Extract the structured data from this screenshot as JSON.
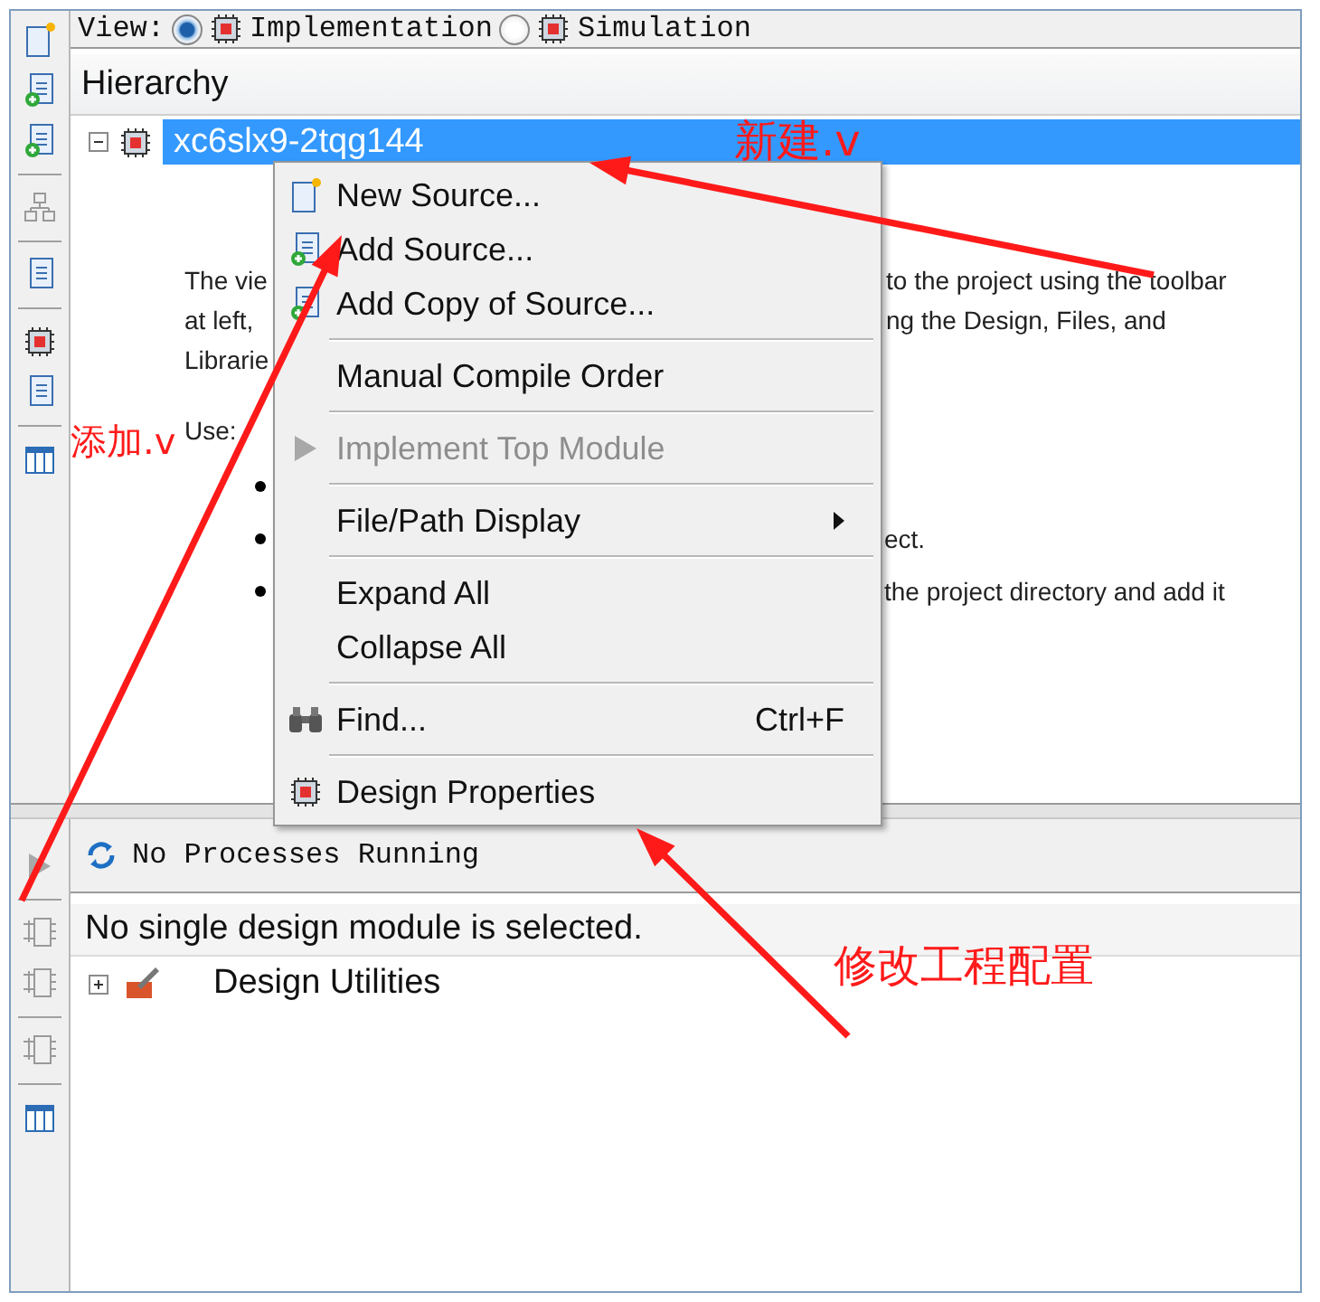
{
  "view_bar": {
    "label": "View:",
    "options": [
      {
        "label": "Implementation",
        "selected": true
      },
      {
        "label": "Simulation",
        "selected": false
      }
    ]
  },
  "hierarchy": {
    "title": "Hierarchy",
    "root": {
      "label": "xc6slx9-2tqg144",
      "selected": true,
      "expanded": true
    },
    "description": [
      {
        "left": "The vie",
        "right": "to the project using the toolbar"
      },
      {
        "left": "at left,",
        "right": "ng the Design, Files, and"
      },
      {
        "left": "Librarie"
      }
    ],
    "use_label": "Use:",
    "bullets": [
      {
        "kind": "bullet"
      },
      {
        "kind": "bullet",
        "right": "ect."
      },
      {
        "kind": "bullet",
        "right": "the project directory and add it"
      }
    ]
  },
  "context_menu": {
    "items": [
      {
        "kind": "item",
        "label": "New Source...",
        "disabled": false
      },
      {
        "kind": "item",
        "label": "Add Source...",
        "disabled": false
      },
      {
        "kind": "item",
        "label": "Add Copy of Source...",
        "disabled": false
      },
      {
        "kind": "separator"
      },
      {
        "kind": "item",
        "label": "Manual Compile Order",
        "disabled": false
      },
      {
        "kind": "separator"
      },
      {
        "kind": "item",
        "label": "Implement Top Module",
        "disabled": true
      },
      {
        "kind": "separator"
      },
      {
        "kind": "item",
        "label": "File/Path Display",
        "disabled": false,
        "submenu": true
      },
      {
        "kind": "separator"
      },
      {
        "kind": "item",
        "label": "Expand All",
        "disabled": false
      },
      {
        "kind": "item",
        "label": "Collapse All",
        "disabled": false
      },
      {
        "kind": "separator"
      },
      {
        "kind": "item",
        "label": "Find...",
        "disabled": false,
        "shortcut": "Ctrl+F"
      },
      {
        "kind": "separator"
      },
      {
        "kind": "item",
        "label": "Design Properties",
        "disabled": false
      }
    ]
  },
  "processes": {
    "status": "No Processes Running",
    "message": "No single design module is selected.",
    "items": [
      {
        "label": "Design Utilities",
        "expanded": false
      }
    ]
  },
  "annotations": [
    {
      "text": "新建.v"
    },
    {
      "text": "添加.v"
    },
    {
      "text": "修改工程配置"
    }
  ]
}
